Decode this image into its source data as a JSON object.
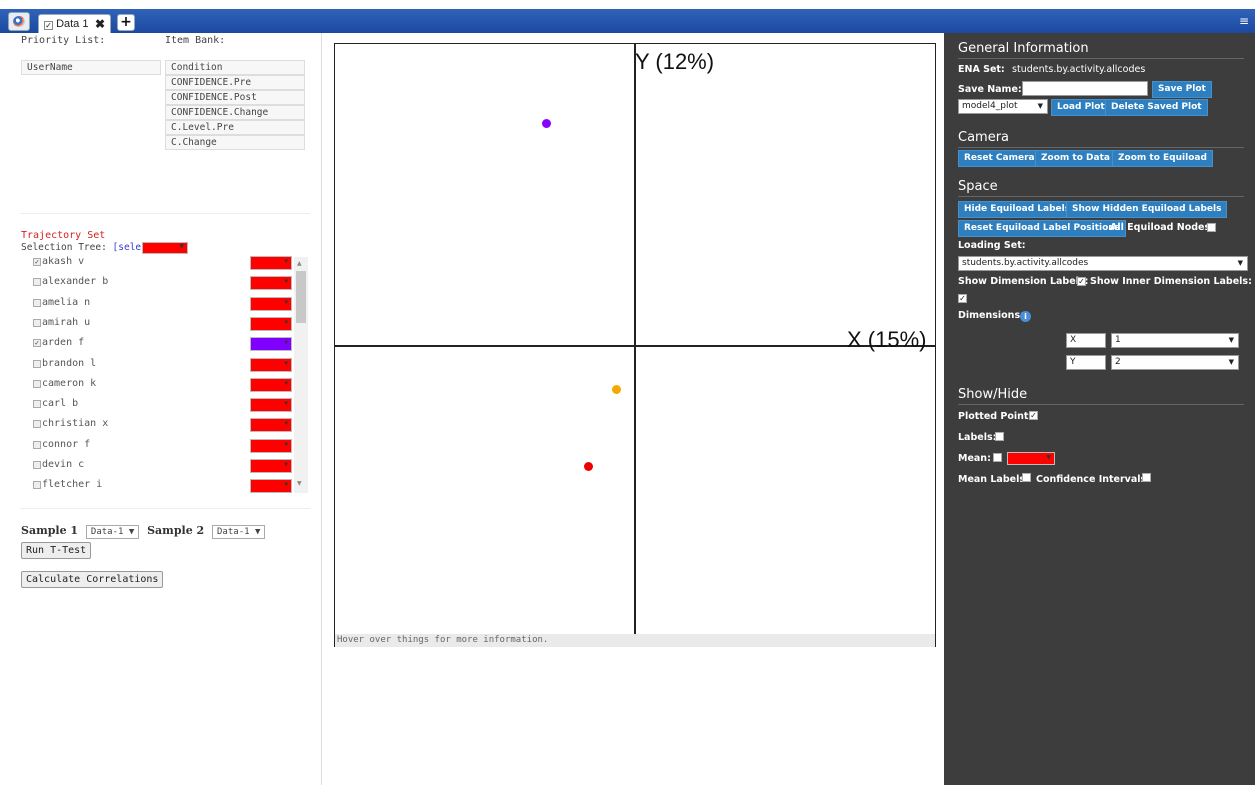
{
  "tab": {
    "label": "Data 1",
    "check": "✓",
    "close": "✖",
    "add": "+"
  },
  "menu_icon": "≡",
  "left": {
    "priority_header": "Priority List:",
    "itembank_header": "Item Bank:",
    "priority_items": [
      "UserName"
    ],
    "itembank_items": [
      "Condition",
      "CONFIDENCE.Pre",
      "CONFIDENCE.Post",
      "CONFIDENCE.Change",
      "C.Level.Pre",
      "C.Change"
    ],
    "trajectory_title": "Trajectory Set",
    "selection_tree_label": "Selection Tree:",
    "select_all": "[select all]",
    "trajectories": [
      {
        "name": "akash v",
        "checked": true,
        "color": "#ff0000"
      },
      {
        "name": "alexander b",
        "checked": false,
        "color": "#ff0000"
      },
      {
        "name": "amelia n",
        "checked": false,
        "color": "#ff0000"
      },
      {
        "name": "amirah u",
        "checked": false,
        "color": "#ff0000"
      },
      {
        "name": "arden f",
        "checked": true,
        "color": "#8000ff"
      },
      {
        "name": "brandon l",
        "checked": false,
        "color": "#ff0000"
      },
      {
        "name": "cameron k",
        "checked": false,
        "color": "#ff0000"
      },
      {
        "name": "carl b",
        "checked": false,
        "color": "#ff0000"
      },
      {
        "name": "christian x",
        "checked": false,
        "color": "#ff0000"
      },
      {
        "name": "connor f",
        "checked": false,
        "color": "#ff0000"
      },
      {
        "name": "devin c",
        "checked": false,
        "color": "#ff0000"
      },
      {
        "name": "fletcher i",
        "checked": false,
        "color": "#ff0000"
      }
    ],
    "sample1_label": "Sample 1",
    "sample1_value": "Data-1 ▼",
    "sample2_label": "Sample 2",
    "sample2_value": "Data-1 ▼",
    "run_ttest": "Run T-Test",
    "calc_corr": "Calculate Correlations"
  },
  "plot": {
    "y_label": "Y (12%)",
    "x_label": "X (15%)",
    "hover_text": "Hover over things for more information.",
    "points": [
      {
        "color": "#8a00ff"
      },
      {
        "color": "#f5a800"
      },
      {
        "color": "#ee0000"
      }
    ]
  },
  "right": {
    "general_title": "General Information",
    "ena_set_label": "ENA Set:",
    "ena_set_value": "students.by.activity.allcodes",
    "save_name_label": "Save Name:",
    "save_plot": "Save Plot",
    "plot_select": "model4_plot",
    "load_plot": "Load Plot",
    "delete_plot": "Delete Saved Plot",
    "camera_title": "Camera",
    "reset_camera": "Reset Camera",
    "zoom_data": "Zoom to Data",
    "zoom_equiload": "Zoom to Equiload",
    "space_title": "Space",
    "hide_labels": "Hide Equiload Labels",
    "show_hidden": "Show Hidden Equiload Labels",
    "reset_positions": "Reset Equiload Label Positions",
    "all_nodes": "All Equiload Nodes:",
    "loading_set_label": "Loading Set:",
    "loading_set_value": "students.by.activity.allcodes",
    "show_dim_labels": "Show Dimension Labels:",
    "show_inner_dim": "Show Inner Dimension Labels:",
    "dimensions_label": "Dimensions:",
    "dim_x_name": "X",
    "dim_x_value": "1",
    "dim_y_name": "Y",
    "dim_y_value": "2",
    "showhide_title": "Show/Hide",
    "plotted_points": "Plotted Points:",
    "labels": "Labels:",
    "mean": "Mean:",
    "mean_labels": "Mean Labels:",
    "conf_intervals": "Confidence Intervals:",
    "check_mark": "✓",
    "info": "i"
  }
}
